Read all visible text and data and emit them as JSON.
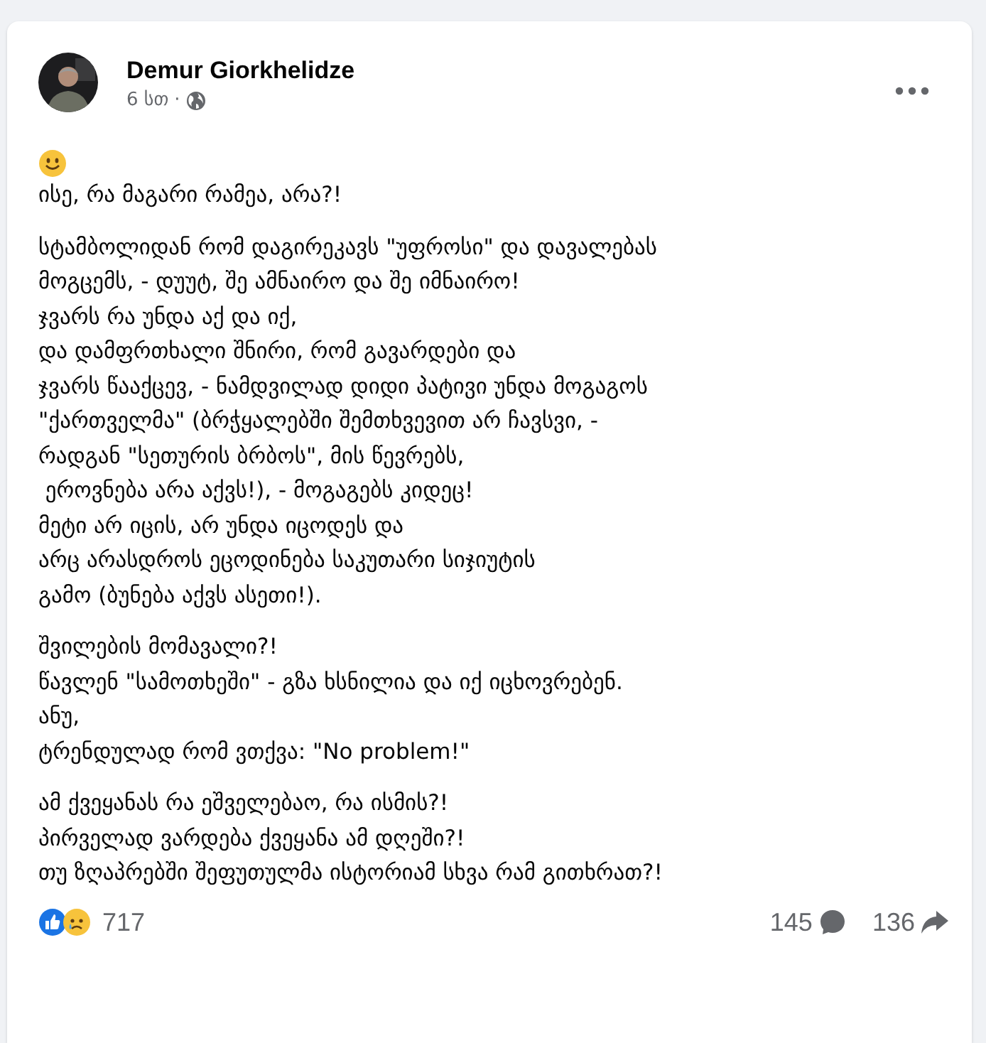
{
  "post": {
    "author": "Demur Giorkhelidze",
    "time": "6 სთ",
    "separator": "·",
    "paragraphs": [
      [
        "ისე, რა მაგარი რამეა, არა?!"
      ],
      [
        "სტამბოლიდან რომ დაგირეკავს \"უფროსი\" და დავალებას",
        "მოგცემს, - დუუტ, შე ამნაირო და შე იმნაირო!",
        "ჯვარს რა უნდა აქ და იქ,",
        "და დამფრთხალი შნირი, რომ გავარდები და",
        "ჯვარს წააქცევ, - ნამდვილად დიდი პატივი უნდა მოგაგოს",
        "\"ქართველმა\" (ბრჭყალებში შემთხვევით არ ჩავსვი, -",
        "რადგან \"სეთურის ბრბოს\", მის წევრებს,",
        " ეროვნება არა აქვს!), - მოგაგებს კიდეც!",
        "მეტი არ იცის, არ უნდა იცოდეს და",
        "არც არასდროს ეცოდინება საკუთარი სიჯიუტის",
        "გამო (ბუნება აქვს ასეთი!)."
      ],
      [
        "შვილების მომავალი?!",
        "წავლენ \"სამოთხეში\" - გზა ხსნილია და იქ იცხოვრებენ.",
        "ანუ,",
        "ტრენდულად რომ ვთქვა: \"No problem!\""
      ],
      [
        "ამ ქვეყანას რა ეშველებაო, რა ისმის?!",
        "პირველად ვარდება ქვეყანა ამ დღეში?!",
        "თუ ზღაპრებში შეფუთულმა ისტორიამ სხვა რამ გითხრათ?!"
      ]
    ],
    "reactions": "717",
    "comments": "145",
    "shares": "136"
  }
}
